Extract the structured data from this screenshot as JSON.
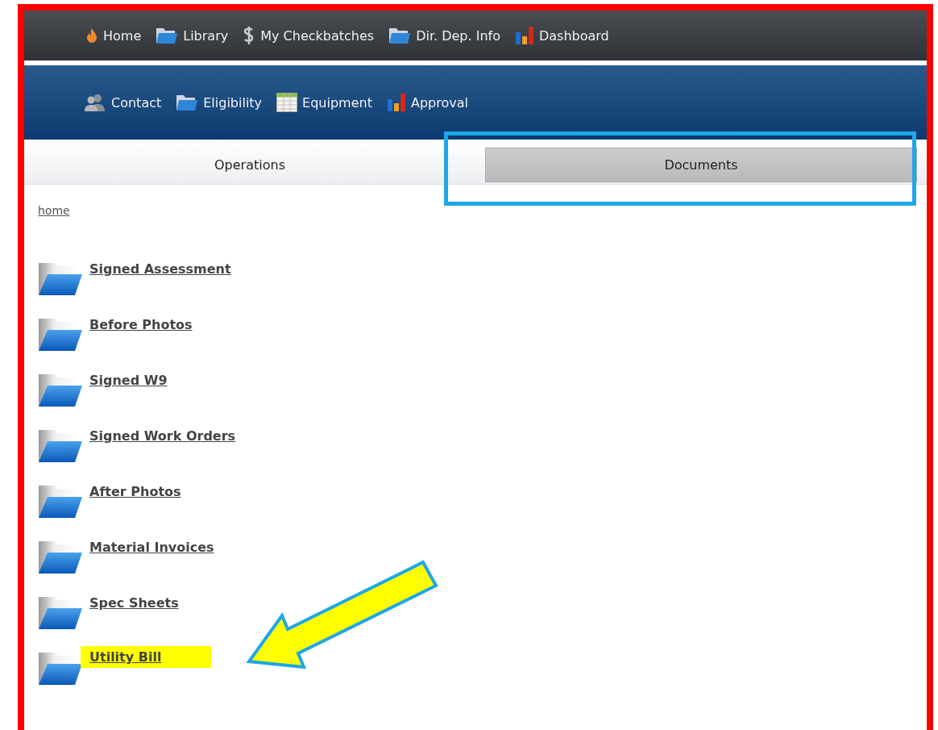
{
  "top_nav": [
    {
      "label": "Home",
      "kind": "flame"
    },
    {
      "label": "Library",
      "kind": "folder"
    },
    {
      "label": "My Checkbatches",
      "kind": "dollar"
    },
    {
      "label": "Dir. Dep. Info",
      "kind": "folder"
    },
    {
      "label": "Dashboard",
      "kind": "chart"
    }
  ],
  "sub_nav": [
    {
      "label": "Contact",
      "kind": "person"
    },
    {
      "label": "Eligibility",
      "kind": "folder"
    },
    {
      "label": "Equipment",
      "kind": "table"
    },
    {
      "label": "Approval",
      "kind": "chart"
    }
  ],
  "tabs": [
    {
      "label": "Operations",
      "selected": false,
      "highlighted": false
    },
    {
      "label": "Documents",
      "selected": true,
      "highlighted": true
    }
  ],
  "breadcrumb": "home",
  "folders": [
    {
      "label": "Signed Assessment",
      "highlighted": false
    },
    {
      "label": "Before Photos",
      "highlighted": false
    },
    {
      "label": "Signed W9",
      "highlighted": false
    },
    {
      "label": "Signed Work Orders",
      "highlighted": false
    },
    {
      "label": "After Photos",
      "highlighted": false
    },
    {
      "label": "Material Invoices",
      "highlighted": false
    },
    {
      "label": "Spec Sheets",
      "highlighted": false
    },
    {
      "label": "Utility Bill",
      "highlighted": true
    }
  ]
}
